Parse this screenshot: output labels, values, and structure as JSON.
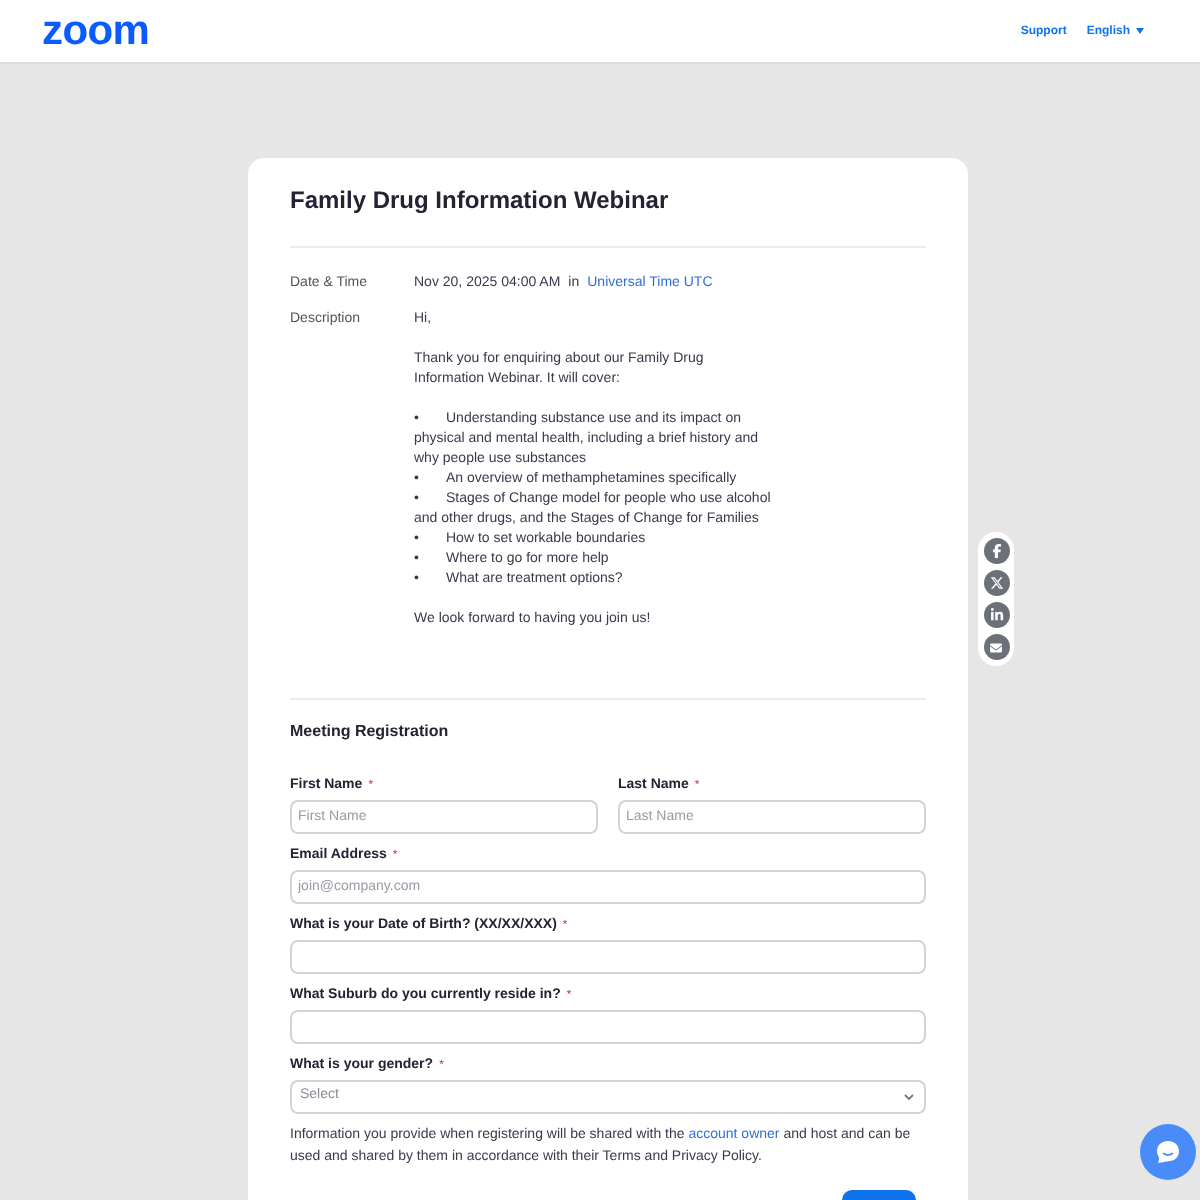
{
  "header": {
    "logo": "zoom",
    "links": [
      {
        "label": "Support",
        "kind": "link"
      },
      {
        "label": "English",
        "kind": "dropdown"
      }
    ]
  },
  "event": {
    "title": "Family Drug Information Webinar",
    "date_time": {
      "label": "Date & Time",
      "value": "Nov 20, 2025 04:00 AM",
      "connector": "in",
      "timezone": "Universal Time UTC"
    },
    "description": {
      "label": "Description",
      "blocks": [
        {
          "kind": "paragraph",
          "text": "Hi,"
        },
        {
          "kind": "paragraph",
          "text": "Thank you for enquiring about our Family Drug Information Webinar. It will cover:"
        },
        {
          "kind": "list",
          "items": [
            {
              "marker": "•",
              "text": "Understanding substance use and its impact on physical and mental health, including a brief history and why people use substances"
            },
            {
              "marker": "•",
              "text": "An overview of methamphetamines specifically"
            },
            {
              "marker": "•",
              "text": "Stages of Change model for people who use alcohol and other drugs, and the Stages of Change for Families"
            },
            {
              "marker": "•",
              "text": "How to set workable boundaries"
            },
            {
              "marker": "•",
              "text": "Where to go for more help"
            },
            {
              "marker": "•",
              "text": "What are treatment options?"
            }
          ]
        },
        {
          "kind": "paragraph",
          "text": "We look forward to having you join us!"
        }
      ]
    }
  },
  "registration": {
    "title": "Meeting Registration",
    "rows": [
      [
        {
          "kind": "text",
          "label": "First Name",
          "required_mark": "*",
          "placeholder": "First Name"
        },
        {
          "kind": "text",
          "label": "Last Name",
          "required_mark": "*",
          "placeholder": "Last Name"
        }
      ],
      [
        {
          "kind": "text",
          "label": "Email Address",
          "required_mark": "*",
          "placeholder": "join@company.com"
        }
      ],
      [
        {
          "kind": "text",
          "label": "What is your Date of Birth? (XX/XX/XXX)",
          "required_mark": "*"
        }
      ],
      [
        {
          "kind": "text",
          "label": "What Suburb do you currently reside in?",
          "required_mark": "*"
        }
      ],
      [
        {
          "kind": "select",
          "label": "What is your gender?",
          "required_mark": "*",
          "placeholder": "Select"
        }
      ]
    ],
    "notice": {
      "before": "Information you provide when registering will be shared with the ",
      "link": "account owner",
      "after": " and host and can be used and shared by them in accordance with their Terms and Privacy Policy."
    }
  }
}
